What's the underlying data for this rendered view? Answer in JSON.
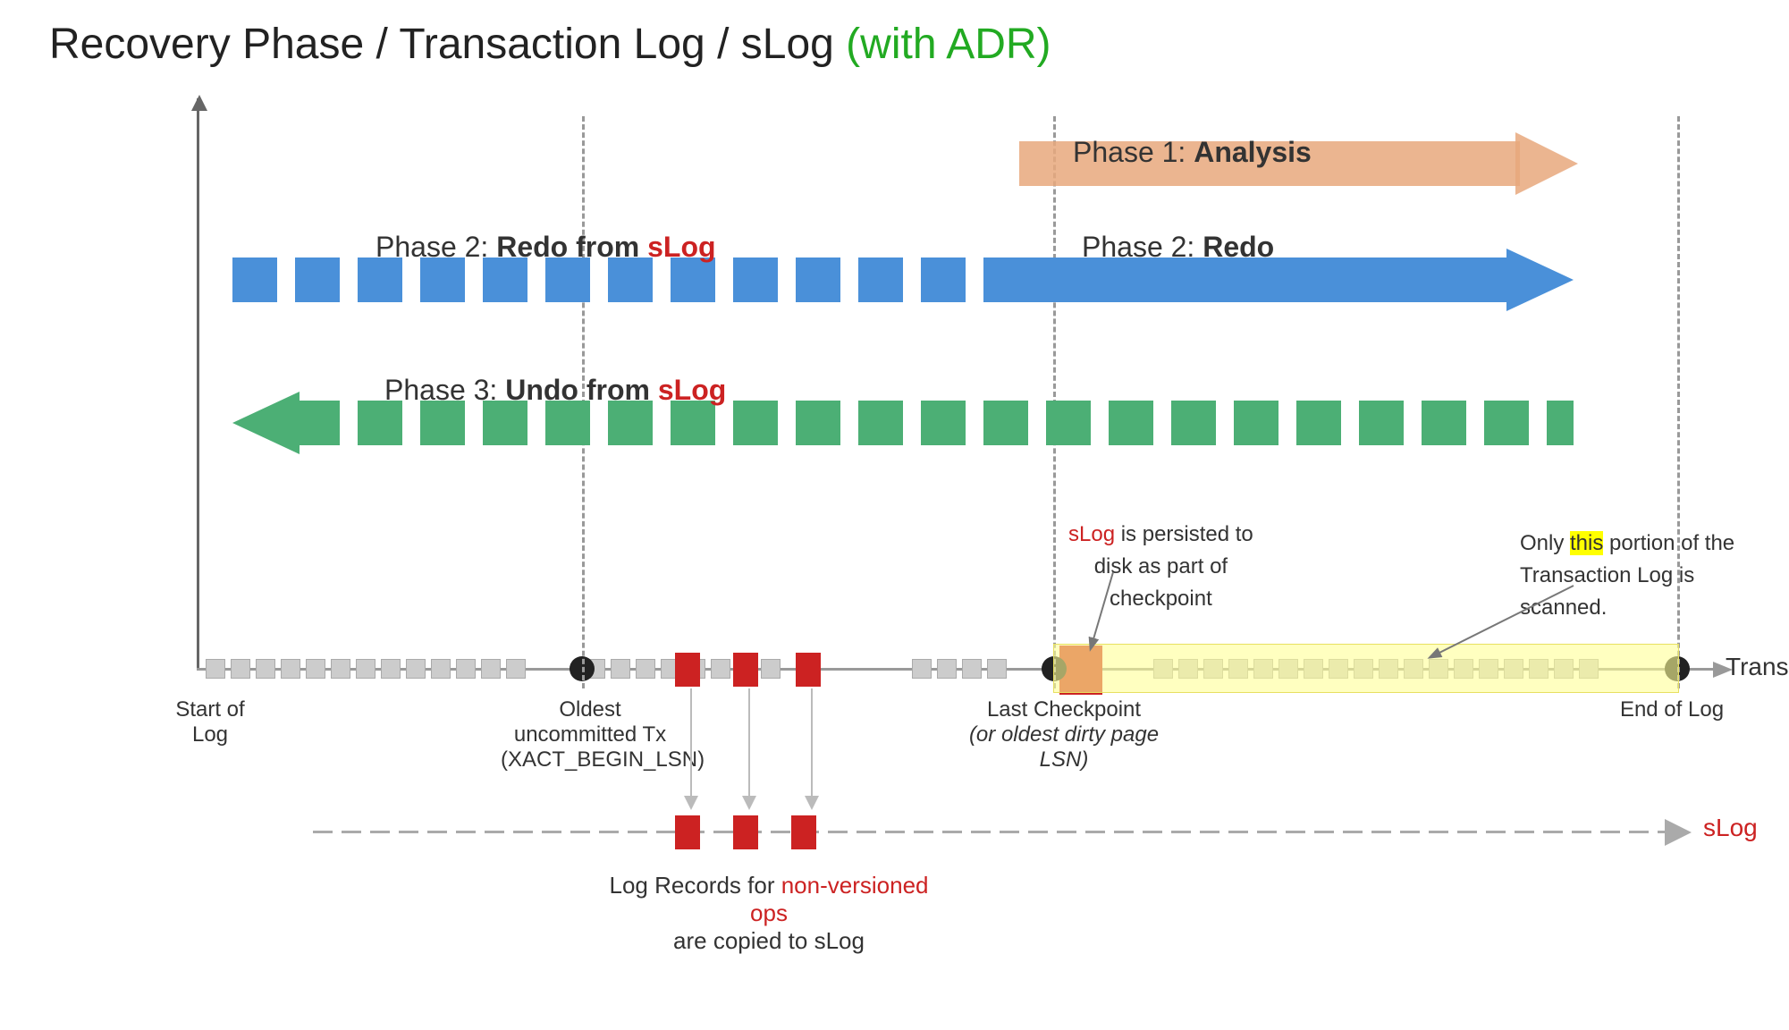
{
  "title": {
    "part1": "Recovery Phase / Transaction Log / sLog ",
    "part2": "(with ADR)"
  },
  "phases": {
    "analysis_label": "Phase 1: ",
    "analysis_bold": "Analysis",
    "redo_slog_label": "Phase 2: ",
    "redo_slog_bold": "Redo from ",
    "redo_slog_red": "sLog",
    "redo_label": "Phase 2: ",
    "redo_bold": "Redo",
    "undo_slog_label": "Phase 3: ",
    "undo_slog_bold": "Undo from ",
    "undo_slog_red": "sLog"
  },
  "log_labels": {
    "start": "Start of Log",
    "oldest_uncommitted": "Oldest uncommitted Tx",
    "xact_begin": "(XACT_BEGIN_LSN)",
    "last_checkpoint": "Last Checkpoint",
    "last_checkpoint_sub": "(or oldest dirty page",
    "last_checkpoint_sub2": "LSN)",
    "end": "End of Log",
    "transaction_log": "Transaction Log"
  },
  "slog_label": "sLog",
  "slog_persisted": "sLog is persisted to",
  "slog_persisted2": "disk as part of",
  "slog_persisted3": "checkpoint",
  "annotation": {
    "line1": "Only ",
    "highlight": "this",
    "line1b": " portion of the",
    "line2": "Transaction Log is scanned."
  },
  "log_records": {
    "line1": "Log Records for ",
    "red_text": "non-versioned ops",
    "line2": "are copied to sLog"
  },
  "colors": {
    "orange": "#E8A87C",
    "blue": "#4A90D9",
    "green": "#4CAF75",
    "red": "#CC2222",
    "dark": "#333333",
    "green_title": "#22aa22"
  }
}
